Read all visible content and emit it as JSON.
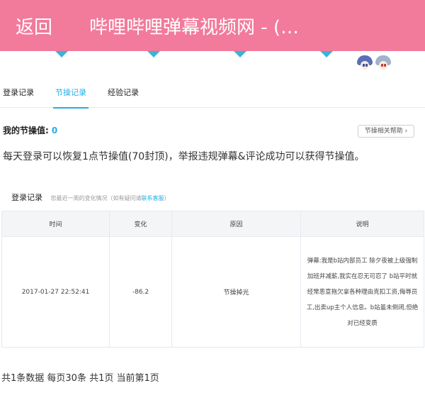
{
  "header": {
    "back_label": "返回",
    "title": "哔哩哔哩弹幕视频网 - (…"
  },
  "tabs": [
    {
      "label": "登录记录",
      "active": false
    },
    {
      "label": "节操记录",
      "active": true
    },
    {
      "label": "经验记录",
      "active": false
    }
  ],
  "jiecao": {
    "label": "我的节操值:",
    "value": "0",
    "help_label": "节操相关帮助"
  },
  "info_text": "每天登录可以恢复1点节操值(70封顶)，举报违规弹幕&评论成功可以获得节操值。",
  "section": {
    "title": "登录记录",
    "hint": "您最近一周的变化情况（如有疑问请",
    "link": "联系客服",
    "hint_end": "）"
  },
  "table": {
    "headers": [
      "时间",
      "变化",
      "原因",
      "说明"
    ],
    "rows": [
      {
        "time": "2017-01-27 22:52:41",
        "change": "-86.2",
        "reason": "节操掉光",
        "note_lines": [
          "弹幕:我是b站内部员工 除夕夜被上级强制",
          "加班并减薪,我实在忍无可忍了 b站平时就",
          "经常恶意拖欠拿各种理由克扣工资,侮辱员",
          "工,出卖up主个人信息。b站虽未倒闭,但绝",
          "对已经变质"
        ]
      }
    ]
  },
  "pager": "共1条数据 每页30条 共1页 当前第1页",
  "colors": {
    "header_bg": "#f27a9b",
    "accent": "#23ade5"
  }
}
